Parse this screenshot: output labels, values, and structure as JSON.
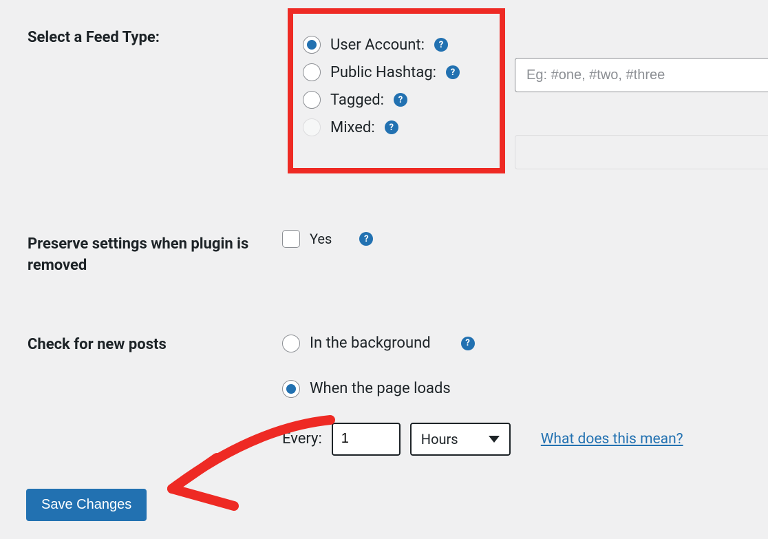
{
  "feed_type": {
    "label": "Select a Feed Type:",
    "options": [
      {
        "label": "User Account:",
        "checked": true,
        "disabled": false
      },
      {
        "label": "Public Hashtag:",
        "checked": false,
        "disabled": false
      },
      {
        "label": "Tagged:",
        "checked": false,
        "disabled": false
      },
      {
        "label": "Mixed:",
        "checked": false,
        "disabled": true
      }
    ],
    "hashtag_placeholder": "Eg: #one, #two, #three"
  },
  "preserve": {
    "label": "Preserve settings when plugin is removed",
    "checkbox_label": "Yes",
    "checked": false
  },
  "check_posts": {
    "label": "Check for new posts",
    "options": [
      {
        "label": "In the background",
        "checked": false
      },
      {
        "label": "When the page loads",
        "checked": true
      }
    ],
    "every_label": "Every:",
    "every_value": "1",
    "unit_selected": "Hours",
    "help_link": "What does this mean?"
  },
  "save_button": "Save Changes",
  "help_glyph": "?"
}
